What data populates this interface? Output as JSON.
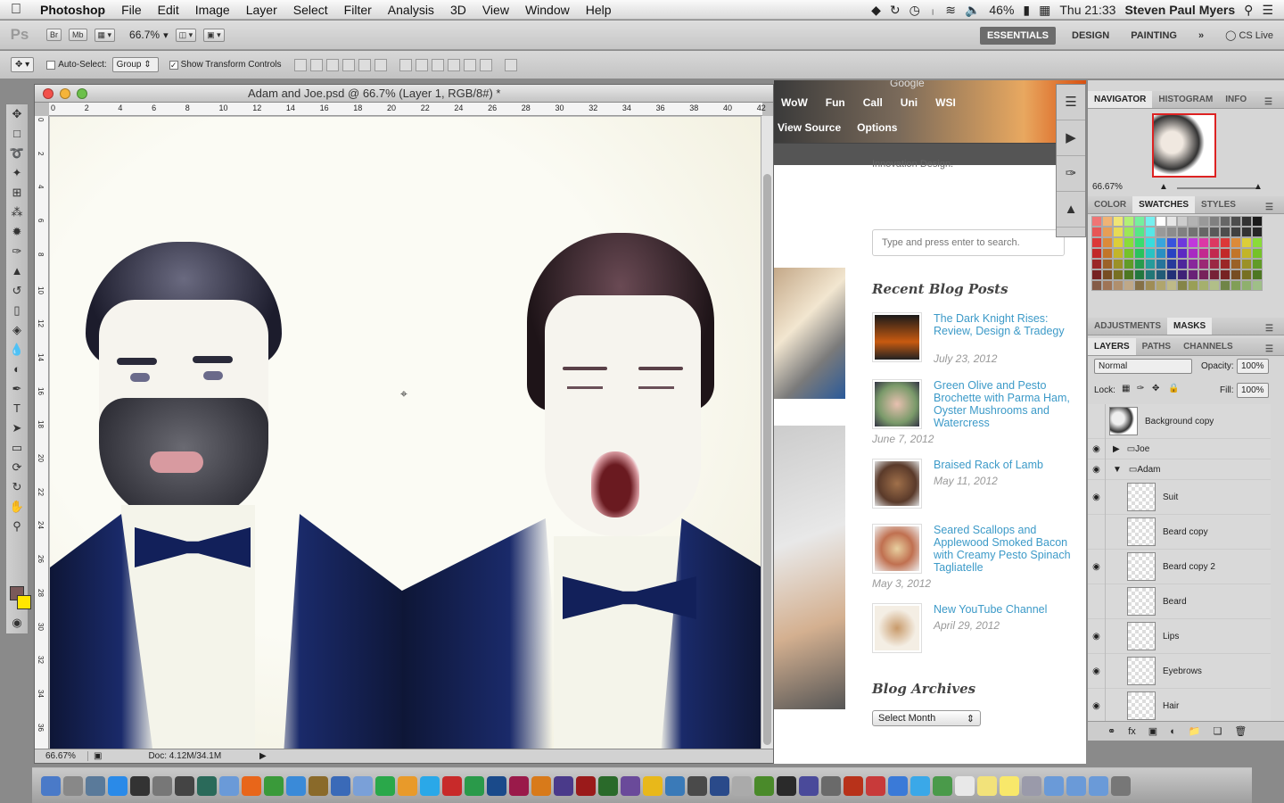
{
  "menubar": {
    "app": "Photoshop",
    "items": [
      "File",
      "Edit",
      "Image",
      "Layer",
      "Select",
      "Filter",
      "Analysis",
      "3D",
      "View",
      "Window",
      "Help"
    ],
    "battery": "46%",
    "clock": "Thu 21:33",
    "user": "Steven Paul Myers"
  },
  "appbar": {
    "logo": "Ps",
    "br": "Br",
    "mb": "Mb",
    "zoom": "66.7%",
    "workspaces": [
      "ESSENTIALS",
      "DESIGN",
      "PAINTING"
    ],
    "more": "»",
    "cslive": "CS Live"
  },
  "options": {
    "auto_select_label": "Auto-Select:",
    "auto_select_value": "Group",
    "transform_label": "Show Transform Controls"
  },
  "document": {
    "title": "Adam and Joe.psd @ 66.7% (Layer 1, RGB/8#) *",
    "ruler_h": [
      "0",
      "2",
      "4",
      "6",
      "8",
      "10",
      "12",
      "14",
      "16",
      "18",
      "20",
      "22",
      "24",
      "26",
      "28",
      "30",
      "32",
      "34",
      "36",
      "38",
      "40",
      "42"
    ],
    "ruler_v": [
      "0",
      "2",
      "4",
      "6",
      "8",
      "10",
      "12",
      "14",
      "16",
      "18",
      "20",
      "22",
      "24",
      "26",
      "28",
      "30",
      "32",
      "34",
      "36"
    ],
    "status_zoom": "66.67%",
    "status_doc": "Doc: 4.12M/34.1M"
  },
  "browser": {
    "nav": [
      "WoW",
      "Fun",
      "Call",
      "Uni",
      "WSI"
    ],
    "view_source": "View Source",
    "options": "Options",
    "google": "Google",
    "tagline": "Innovation Design.",
    "search_placeholder": "Type and press enter to search.",
    "recent_heading": "Recent Blog Posts",
    "posts": [
      {
        "title": "The Dark Knight Rises: Review, Design & Tradegy",
        "date": "July 23, 2012"
      },
      {
        "title": "Green Olive and Pesto Brochette with Parma Ham, Oyster Mushrooms and Watercress",
        "date": "June 7, 2012"
      },
      {
        "title": "Braised Rack of Lamb",
        "date": "May 11, 2012"
      },
      {
        "title": "Seared Scallops and Applewood Smoked Bacon with Creamy Pesto Spinach Tagliatelle",
        "date": "May 3, 2012"
      },
      {
        "title": "New YouTube Channel",
        "date": "April 29, 2012"
      }
    ],
    "archives_heading": "Blog Archives",
    "archives_select": "Select Month"
  },
  "panels": {
    "navigator_tabs": [
      "NAVIGATOR",
      "HISTOGRAM",
      "INFO"
    ],
    "navigator_zoom": "66.67%",
    "color_tabs": [
      "COLOR",
      "SWATCHES",
      "STYLES"
    ],
    "adj_tabs": [
      "ADJUSTMENTS",
      "MASKS"
    ],
    "layer_tabs": [
      "LAYERS",
      "PATHS",
      "CHANNELS"
    ],
    "blend_mode": "Normal",
    "opacity_label": "Opacity:",
    "opacity": "100%",
    "lock_label": "Lock:",
    "fill_label": "Fill:",
    "fill": "100%",
    "layers": [
      {
        "name": "Background copy",
        "kind": "layer",
        "visible": false
      },
      {
        "name": "Joe",
        "kind": "group",
        "visible": true
      },
      {
        "name": "Adam",
        "kind": "group",
        "visible": true
      },
      {
        "name": "Suit",
        "kind": "layer",
        "visible": true
      },
      {
        "name": "Beard copy",
        "kind": "layer",
        "visible": false
      },
      {
        "name": "Beard copy 2",
        "kind": "layer",
        "visible": true
      },
      {
        "name": "Beard",
        "kind": "layer",
        "visible": false
      },
      {
        "name": "Lips",
        "kind": "layer",
        "visible": true
      },
      {
        "name": "Eyebrows",
        "kind": "layer",
        "visible": true
      },
      {
        "name": "Hair",
        "kind": "layer",
        "visible": true
      }
    ]
  },
  "colors": {
    "foreground": "#7a5a5a",
    "background": "#ffe600",
    "link": "#3c9ac8",
    "suit": "#1a2a5a"
  },
  "dock": [
    "Finder",
    "Launchpad",
    "Mail",
    "App Store",
    "Terminal",
    "System Preferences",
    "Dashboard",
    "Time Machine",
    "Preview",
    "Firefox",
    "Chrome",
    "Safari",
    "WoW",
    "Vuze",
    "iTunes",
    "Spotify",
    "Keynote",
    "Skype",
    "Photo Booth",
    "Google Drive",
    "Ps",
    "Id",
    "Ai",
    "AE",
    "Fl",
    "Dw",
    "Br",
    "VLC",
    "iCal",
    "Final Cut",
    "Quicktime",
    "iStat",
    "Picasa",
    "Lightroom",
    "Cyberduck",
    "Gimp",
    "FileZilla",
    "Parallels",
    "Dropbox",
    "Twitter",
    "Adium",
    "Reminders",
    "Stickies",
    "Notes",
    "Home",
    "Applications",
    "Documents",
    "Downloads",
    "Trash"
  ]
}
